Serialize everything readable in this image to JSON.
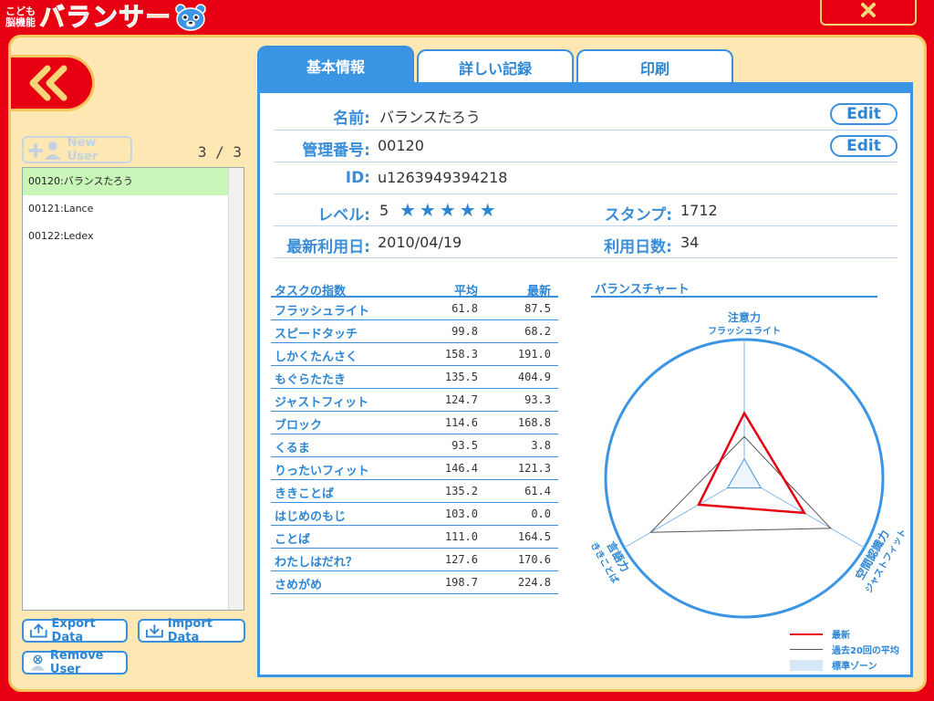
{
  "app": {
    "logo_small_top": "こども",
    "logo_small_bottom": "脳機能",
    "logo_main": "バランサー",
    "close_label": "×"
  },
  "colors": {
    "brand_red": "#e60012",
    "panel_bg": "#fde8b4",
    "accent_blue": "#3b95e4",
    "latest_red": "#e60012",
    "avg_gray": "#555555"
  },
  "sidebar": {
    "new_user_label": "New User",
    "count": "3 / 3",
    "users": [
      {
        "label": "00120:バランスたろう",
        "selected": true
      },
      {
        "label": "00121:Lance",
        "selected": false
      },
      {
        "label": "00122:Ledex",
        "selected": false
      }
    ],
    "export_label": "Export Data",
    "import_label": "Import Data",
    "remove_label": "Remove User"
  },
  "tabs": [
    {
      "label": "基本情報",
      "active": true
    },
    {
      "label": "詳しい記録",
      "active": false
    },
    {
      "label": "印刷",
      "active": false
    }
  ],
  "info": {
    "name_label": "名前:",
    "name_value": "バランスたろう",
    "mgmt_label": "管理番号:",
    "mgmt_value": "00120",
    "edit_label": "Edit",
    "id_label": "ID:",
    "id_value": "u1263949394218",
    "level_label": "レベル:",
    "level_value": "5",
    "level_stars": "★★★★★",
    "stamp_label": "スタンプ:",
    "stamp_value": "1712",
    "last_use_label": "最新利用日:",
    "last_use_value": "2010/04/19",
    "days_label": "利用日数:",
    "days_value": "34"
  },
  "tasks": {
    "header_name": "タスクの指数",
    "header_avg": "平均",
    "header_new": "最新",
    "rows": [
      {
        "name": "フラッシュライト",
        "avg": "61.8",
        "new": "87.5"
      },
      {
        "name": "スピードタッチ",
        "avg": "99.8",
        "new": "68.2"
      },
      {
        "name": "しかくたんさく",
        "avg": "158.3",
        "new": "191.0"
      },
      {
        "name": "もぐらたたき",
        "avg": "135.5",
        "new": "404.9"
      },
      {
        "name": "ジャストフィット",
        "avg": "124.7",
        "new": "93.3"
      },
      {
        "name": "ブロック",
        "avg": "114.6",
        "new": "168.8"
      },
      {
        "name": "くるま",
        "avg": "93.5",
        "new": "3.8"
      },
      {
        "name": "りったいフィット",
        "avg": "146.4",
        "new": "121.3"
      },
      {
        "name": "ききことば",
        "avg": "135.2",
        "new": "61.4"
      },
      {
        "name": "はじめのもじ",
        "avg": "103.0",
        "new": "0.0"
      },
      {
        "name": "ことば",
        "avg": "111.0",
        "new": "164.5"
      },
      {
        "name": "わたしはだれ？",
        "avg": "127.6",
        "new": "170.6"
      },
      {
        "name": "さめがめ",
        "avg": "198.7",
        "new": "224.8"
      }
    ]
  },
  "chart_data": {
    "type": "radar",
    "title": "バランスチャート",
    "axes": [
      {
        "name": "注意力",
        "sub": "フラッシュライト"
      },
      {
        "name": "空間認識力",
        "sub": "ジャストフィット"
      },
      {
        "name": "言語力",
        "sub": "ききことば"
      }
    ],
    "series": [
      {
        "name": "最新",
        "values": [
          0.47,
          0.5,
          0.38
        ]
      },
      {
        "name": "過去20回の平均",
        "values": [
          0.3,
          0.72,
          0.78
        ]
      }
    ],
    "legend": [
      "最新",
      "過去20回の平均",
      "標準ゾーン"
    ],
    "legend_position": "bottom-right"
  }
}
